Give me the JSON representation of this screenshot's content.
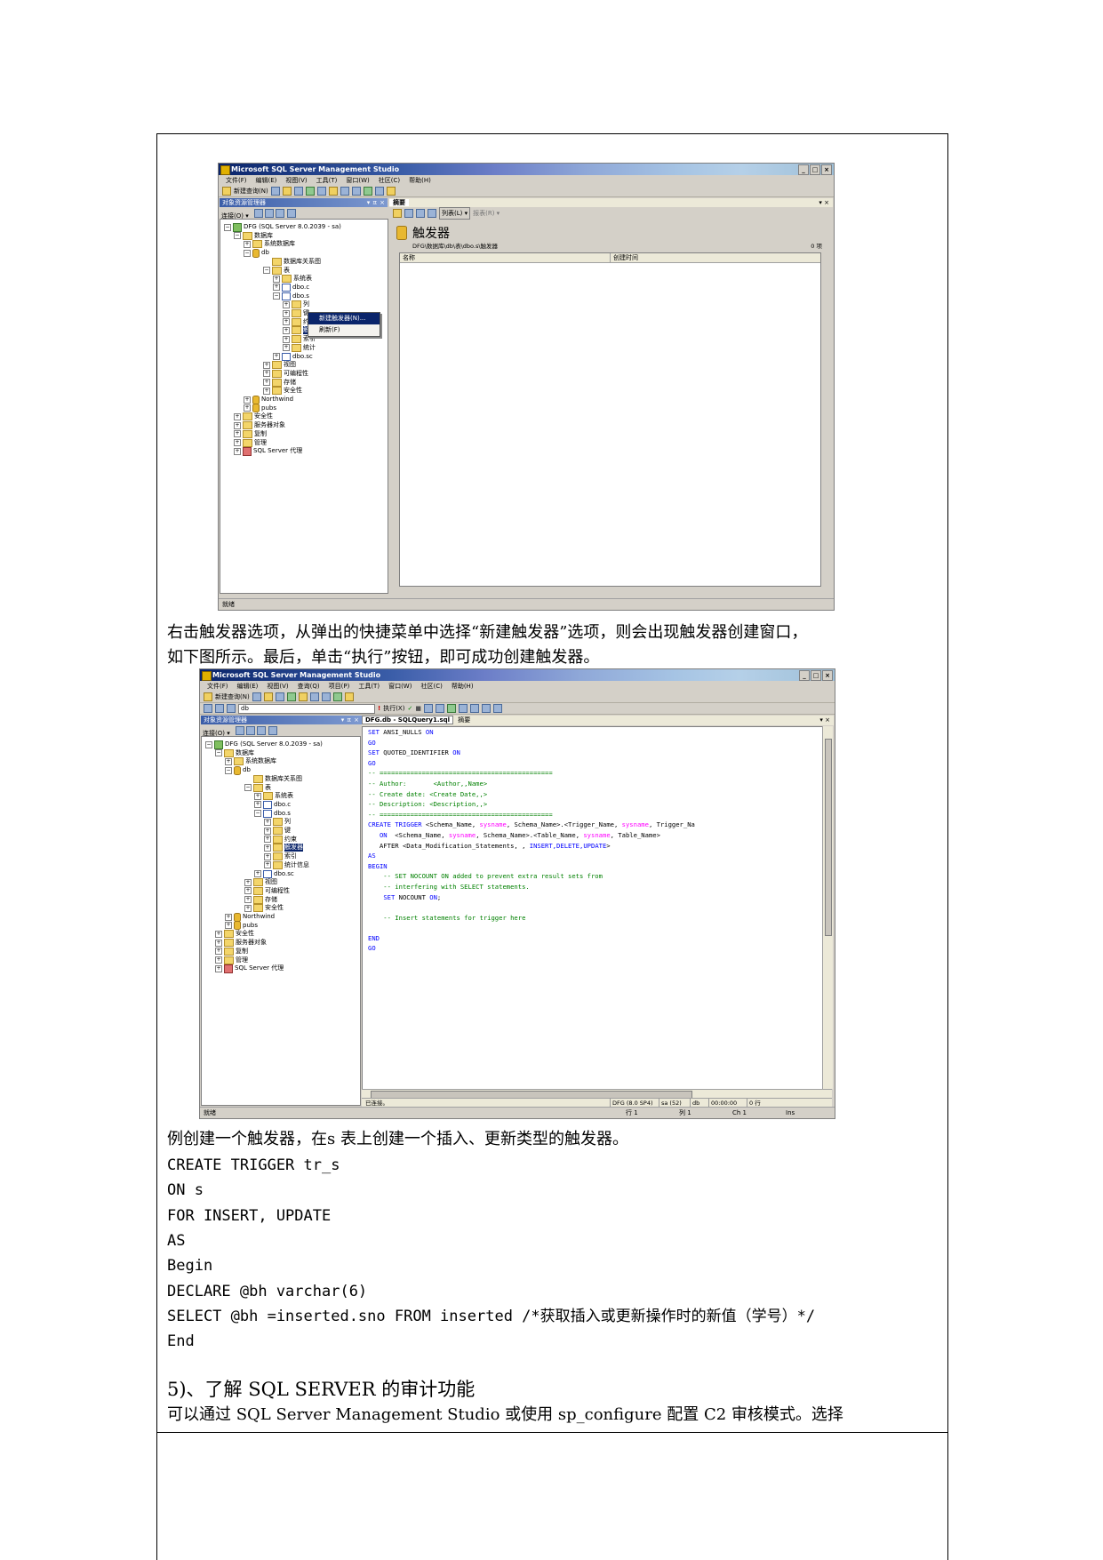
{
  "screenshot1": {
    "title": "Microsoft SQL Server Management Studio",
    "window_buttons": [
      "_",
      "□",
      "×"
    ],
    "menu": [
      "文件(F)",
      "编辑(E)",
      "视图(V)",
      "工具(T)",
      "窗口(W)",
      "社区(C)",
      "帮助(H)"
    ],
    "new_query": "新建查询(N)",
    "explorer_title": "对象资源管理器",
    "explorer_pin": "▾ ㅍ ×",
    "connect": "连接(O) ▾",
    "tree": [
      {
        "label": "DFG (SQL Server 8.0.2039 - sa)",
        "pm": "⊟",
        "icon": "srv"
      },
      {
        "label": "数据库",
        "pm": "⊟",
        "icon": "fold"
      },
      {
        "label": "系统数据库",
        "pm": "⊞",
        "icon": "fold"
      },
      {
        "label": "db",
        "pm": "⊟",
        "icon": "db"
      },
      {
        "label": "数据库关系图",
        "pm": "",
        "icon": "fold"
      },
      {
        "label": "表",
        "pm": "⊟",
        "icon": "fold"
      },
      {
        "label": "系统表",
        "pm": "⊞",
        "icon": "fold"
      },
      {
        "label": "dbo.c",
        "pm": "⊞",
        "icon": "tbl"
      },
      {
        "label": "dbo.s",
        "pm": "⊟",
        "icon": "tbl"
      },
      {
        "label": "列",
        "pm": "⊞",
        "icon": "fold"
      },
      {
        "label": "键",
        "pm": "⊞",
        "icon": "fold"
      },
      {
        "label": "约束",
        "pm": "⊞",
        "icon": "fold"
      },
      {
        "label": "触发器",
        "pm": "⊞",
        "icon": "fold",
        "selected": true
      },
      {
        "label": "索引",
        "pm": "⊞",
        "icon": "fold"
      },
      {
        "label": "统计",
        "pm": "⊞",
        "icon": "fold"
      },
      {
        "label": "dbo.sc",
        "pm": "⊞",
        "icon": "tbl"
      },
      {
        "label": "视图",
        "pm": "⊞",
        "icon": "fold"
      },
      {
        "label": "可编程性",
        "pm": "⊞",
        "icon": "fold"
      },
      {
        "label": "存储",
        "pm": "⊞",
        "icon": "fold"
      },
      {
        "label": "安全性",
        "pm": "⊞",
        "icon": "fold"
      },
      {
        "label": "Northwind",
        "pm": "⊞",
        "icon": "db"
      },
      {
        "label": "pubs",
        "pm": "⊞",
        "icon": "db"
      },
      {
        "label": "安全性",
        "pm": "⊞",
        "icon": "fold"
      },
      {
        "label": "服务器对象",
        "pm": "⊞",
        "icon": "fold"
      },
      {
        "label": "复制",
        "pm": "⊞",
        "icon": "fold"
      },
      {
        "label": "管理",
        "pm": "⊞",
        "icon": "fold"
      },
      {
        "label": "SQL Server 代理",
        "pm": "⊞",
        "icon": "agent"
      }
    ],
    "context_menu": [
      "新建触发器(N)...",
      "刷新(F)"
    ],
    "summary_tab": "摘要",
    "summary_close": "▾ ×",
    "list_btn": "列表(L) ▾",
    "report_btn": "报表(R) ▾",
    "summary_heading": "触发器",
    "summary_path": "DFG\\数据库\\db\\表\\dbo.s\\触发器",
    "summary_count": "0 项",
    "col_name": "名称",
    "col_created": "创建时间",
    "status": "就绪"
  },
  "caption1": [
    "右击触发器选项，从弹出的快捷菜单中选择“新建触发器”选项，则会出现触发器创建窗口，",
    "如下图所示。最后，单击“执行”按钮，即可成功创建触发器。"
  ],
  "screenshot2": {
    "title": "Microsoft SQL Server Management Studio",
    "window_buttons": [
      "_",
      "□",
      "×"
    ],
    "menu": [
      "文件(F)",
      "编辑(E)",
      "视图(V)",
      "查询(Q)",
      "项目(P)",
      "工具(T)",
      "窗口(W)",
      "社区(C)",
      "帮助(H)"
    ],
    "new_query": "新建查询(N)",
    "db_select": "db",
    "execute": "执行(X)",
    "explorer_title": "对象资源管理器",
    "explorer_pin": "▾ ㅍ ×",
    "connect": "连接(O) ▾",
    "tree": [
      {
        "label": "DFG (SQL Server 8.0.2039 - sa)",
        "pm": "⊟",
        "icon": "srv"
      },
      {
        "label": "数据库",
        "pm": "⊟",
        "icon": "fold"
      },
      {
        "label": "系统数据库",
        "pm": "⊞",
        "icon": "fold"
      },
      {
        "label": "db",
        "pm": "⊟",
        "icon": "db"
      },
      {
        "label": "数据库关系图",
        "pm": "",
        "icon": "fold"
      },
      {
        "label": "表",
        "pm": "⊟",
        "icon": "fold"
      },
      {
        "label": "系统表",
        "pm": "⊞",
        "icon": "fold"
      },
      {
        "label": "dbo.c",
        "pm": "⊞",
        "icon": "tbl"
      },
      {
        "label": "dbo.s",
        "pm": "⊟",
        "icon": "tbl"
      },
      {
        "label": "列",
        "pm": "⊞",
        "icon": "fold"
      },
      {
        "label": "键",
        "pm": "⊞",
        "icon": "fold"
      },
      {
        "label": "约束",
        "pm": "⊞",
        "icon": "fold"
      },
      {
        "label": "触发器",
        "pm": "⊞",
        "icon": "fold",
        "selected": true
      },
      {
        "label": "索引",
        "pm": "⊞",
        "icon": "fold"
      },
      {
        "label": "统计信息",
        "pm": "⊞",
        "icon": "fold"
      },
      {
        "label": "dbo.sc",
        "pm": "⊞",
        "icon": "tbl"
      },
      {
        "label": "视图",
        "pm": "⊞",
        "icon": "fold"
      },
      {
        "label": "可编程性",
        "pm": "⊞",
        "icon": "fold"
      },
      {
        "label": "存储",
        "pm": "⊞",
        "icon": "fold"
      },
      {
        "label": "安全性",
        "pm": "⊞",
        "icon": "fold"
      },
      {
        "label": "Northwind",
        "pm": "⊞",
        "icon": "db"
      },
      {
        "label": "pubs",
        "pm": "⊞",
        "icon": "db"
      },
      {
        "label": "安全性",
        "pm": "⊞",
        "icon": "fold"
      },
      {
        "label": "服务器对象",
        "pm": "⊞",
        "icon": "fold"
      },
      {
        "label": "复制",
        "pm": "⊞",
        "icon": "fold"
      },
      {
        "label": "管理",
        "pm": "⊞",
        "icon": "fold"
      },
      {
        "label": "SQL Server 代理",
        "pm": "⊞",
        "icon": "agent"
      }
    ],
    "tab_query": "DFG.db - SQLQuery1.sql",
    "tab_summary": "摘要",
    "editor_close": "▾ ×",
    "code": [
      [
        [
          "kw",
          "SET"
        ],
        [
          "",
          " ANSI_NULLS "
        ],
        [
          "kw",
          "ON"
        ]
      ],
      [
        [
          "kw",
          "GO"
        ]
      ],
      [
        [
          "kw",
          "SET"
        ],
        [
          "",
          " QUOTED_IDENTIFIER "
        ],
        [
          "kw",
          "ON"
        ]
      ],
      [
        [
          "kw",
          "GO"
        ]
      ],
      [
        [
          "cm",
          "-- ============================================="
        ]
      ],
      [
        [
          "cm",
          "-- Author:       <Author,,Name>"
        ]
      ],
      [
        [
          "cm",
          "-- Create date: <Create Date,,>"
        ]
      ],
      [
        [
          "cm",
          "-- Description: <Description,,>"
        ]
      ],
      [
        [
          "cm",
          "-- ============================================="
        ]
      ],
      [
        [
          "kw",
          "CREATE TRIGGER "
        ],
        [
          "",
          "<Schema_Name, "
        ],
        [
          "pk",
          "sysname"
        ],
        [
          "",
          ", Schema_Name>.<Trigger_Name, "
        ],
        [
          "pk",
          "sysname"
        ],
        [
          "",
          ", Trigger_Na"
        ]
      ],
      [
        [
          "",
          "   "
        ],
        [
          "kw",
          "ON"
        ],
        [
          "",
          "  <Schema_Name, "
        ],
        [
          "pk",
          "sysname"
        ],
        [
          "",
          ", Schema_Name>.<Table_Name, "
        ],
        [
          "pk",
          "sysname"
        ],
        [
          "",
          ", Table_Name>"
        ]
      ],
      [
        [
          "",
          "   AFTER <Data_Modification_Statements, , "
        ],
        [
          "kw",
          "INSERT,DELETE,UPDATE"
        ],
        [
          "",
          ">"
        ]
      ],
      [
        [
          "kw",
          "AS"
        ]
      ],
      [
        [
          "kw",
          "BEGIN"
        ]
      ],
      [
        [
          "cm",
          "    -- SET NOCOUNT ON added to prevent extra result sets from"
        ]
      ],
      [
        [
          "cm",
          "    -- interfering with SELECT statements."
        ]
      ],
      [
        [
          "",
          "    "
        ],
        [
          "kw",
          "SET"
        ],
        [
          "",
          " NOCOUNT "
        ],
        [
          "kw",
          "ON"
        ],
        [
          "",
          ";"
        ]
      ],
      [
        [
          "",
          ""
        ]
      ],
      [
        [
          "cm",
          "    -- Insert statements for trigger here"
        ]
      ],
      [
        [
          "",
          ""
        ]
      ],
      [
        [
          "kw",
          "END"
        ]
      ],
      [
        [
          "kw",
          "GO"
        ]
      ]
    ],
    "conn_status": "已连接。",
    "conn_server": "DFG (8.0 SP4)",
    "conn_user": "sa (52)",
    "conn_db": "db",
    "conn_time": "00:00:00",
    "conn_rows": "0 行",
    "status": "就绪",
    "row_label": "行 1",
    "col_label": "列 1",
    "ch_label": "Ch 1",
    "ins_label": "Ins"
  },
  "caption2": "例创建一个触发器，在s 表上创建一个插入、更新类型的触发器。",
  "code_lines": [
    "CREATE TRIGGER tr_s",
    "ON s",
    "FOR INSERT, UPDATE",
    "AS",
    "Begin",
    "DECLARE @bh varchar(6)",
    "SELECT @bh =inserted.sno FROM inserted /*获取插入或更新操作时的新值（学号）*/",
    "End"
  ],
  "section_heading": "5)、了解 SQL SERVER 的审计功能",
  "last_line": "可以通过 SQL Server Management Studio 或使用 sp_configure 配置 C2 审核模式。选择"
}
